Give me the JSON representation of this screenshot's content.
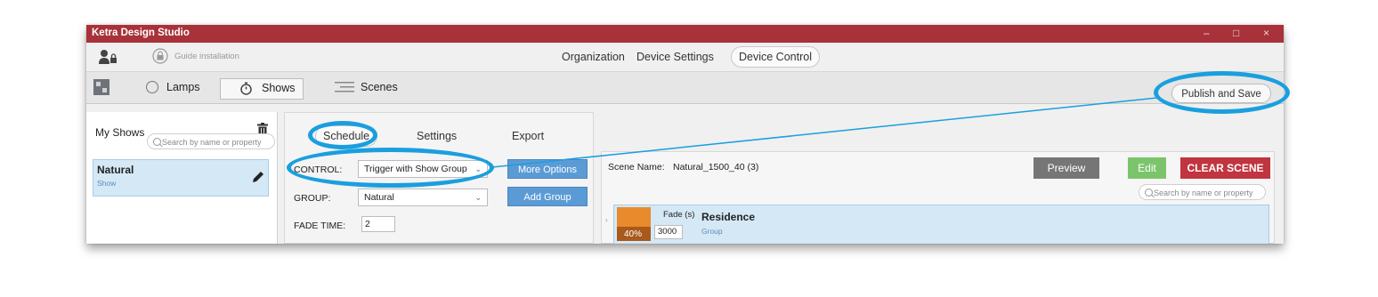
{
  "window": {
    "title": "Ketra Design Studio",
    "controls": {
      "minimize": "–",
      "maximize": "□",
      "close": "×"
    }
  },
  "menubar": {
    "guide_label": "Guide installation",
    "nav": [
      "Organization",
      "Device Settings",
      "Device Control"
    ],
    "active_nav": "Device Control"
  },
  "toolbar": {
    "lamps_label": "Lamps",
    "shows_label": "Shows",
    "scenes_label": "Scenes",
    "publish_label": "Publish and Save"
  },
  "left_panel": {
    "header": "My Shows",
    "search_placeholder": "Search by name or property",
    "items": [
      {
        "name": "Natural",
        "type": "Show"
      }
    ]
  },
  "middle_panel": {
    "tabs": [
      "Schedule",
      "Settings",
      "Export"
    ],
    "active_tab": "Schedule",
    "control_label": "CONTROL:",
    "control_value": "Trigger with Show Group",
    "group_label": "GROUP:",
    "group_value": "Natural",
    "fade_time_label": "FADE TIME:",
    "fade_time_value": "2",
    "more_options_label": "More Options",
    "add_group_label": "Add Group"
  },
  "right_panel": {
    "scene_name_label": "Scene Name:",
    "scene_name_value": "Natural_1500_40 (3)",
    "preview_label": "Preview",
    "edit_label": "Edit",
    "clear_label": "CLEAR SCENE",
    "search_placeholder": "Search by name or property",
    "row": {
      "percent": "40%",
      "fade_label": "Fade (s)",
      "fade_value": "3000",
      "name": "Residence",
      "type": "Group"
    }
  },
  "colors": {
    "titlebar": "#a8313a",
    "callout": "#1a9fde",
    "accent_blue": "#5b9bd5",
    "preview_gray": "#767676",
    "edit_green": "#7cc46c",
    "clear_red": "#c0353f",
    "swatch_orange": "#e98a2c",
    "selection_blue": "#d4e8f6"
  },
  "icons": [
    "user-lock-icon",
    "lock-icon",
    "palette-icon",
    "lamps-circle-icon",
    "stopwatch-icon",
    "scenes-lines-icon",
    "trash-icon",
    "pencil-icon",
    "search-icon",
    "chevron-down-icon"
  ]
}
